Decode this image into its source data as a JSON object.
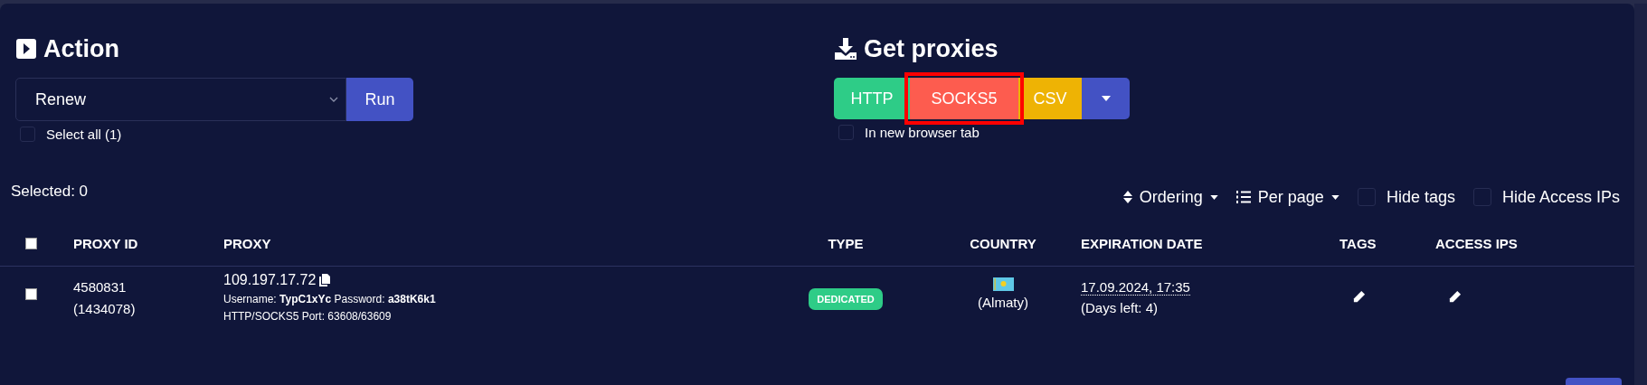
{
  "action": {
    "title": "Action",
    "select": {
      "value": "Renew"
    },
    "run_button": "Run",
    "select_all": {
      "label": "Select all (1)",
      "checked": false
    }
  },
  "get_proxies": {
    "title": "Get proxies",
    "buttons": [
      {
        "label": "HTTP",
        "kind": "http",
        "highlighted": false
      },
      {
        "label": "SOCKS5",
        "kind": "socks",
        "highlighted": true
      },
      {
        "label": "CSV",
        "kind": "csv",
        "highlighted": false
      },
      {
        "kind": "dropdown",
        "highlighted": false
      }
    ],
    "new_tab": {
      "label": "In new browser tab",
      "checked": false
    }
  },
  "selected_count": "Selected: 0",
  "toolbar": {
    "ordering": "Ordering",
    "per_page": "Per page",
    "options": [
      {
        "label": "Hide tags",
        "checked": false
      },
      {
        "label": "Hide Access IPs",
        "checked": false
      }
    ]
  },
  "table": {
    "header_checked": false,
    "columns": [
      "PROXY ID",
      "PROXY",
      "TYPE",
      "COUNTRY",
      "EXPIRATION DATE",
      "TAGS",
      "ACCESS IPS"
    ],
    "rows": [
      {
        "checked": false,
        "proxy_id": "4580831",
        "order_id": "(1434078)",
        "ip": "109.197.17.72",
        "credentials": "Username: **TypC1xYc** Password: **a38tK6k1**",
        "ports": "HTTP/SOCKS5 Port: 63608/63609",
        "type": "DEDICATED",
        "city": "(Almaty)",
        "expiration": "17.09.2024, 17:35",
        "days_left": "(Days left: 4)"
      }
    ]
  }
}
